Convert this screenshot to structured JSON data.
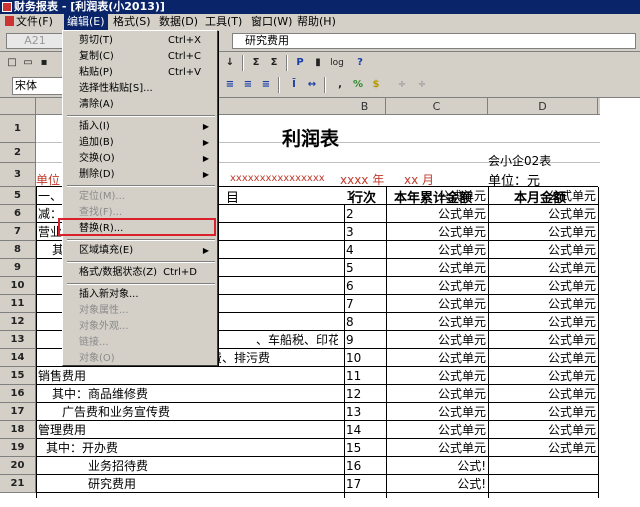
{
  "window": {
    "title": "财务报表 - [利润表(小2013)]"
  },
  "menubar": {
    "items": [
      "文件(F)",
      "编辑(E)",
      "格式(S)",
      "数据(D)",
      "工具(T)",
      "窗口(W)",
      "帮助(H)"
    ]
  },
  "formula_bar": {
    "cell_ref": "A21",
    "content": "研究费用"
  },
  "toolbar": {
    "font": "宋体",
    "zoom_btn": "P",
    "log_btn": "log"
  },
  "edit_menu": {
    "items": [
      {
        "label": "剪切(T)",
        "shortcut": "Ctrl+X"
      },
      {
        "label": "复制(C)",
        "shortcut": "Ctrl+C"
      },
      {
        "label": "粘贴(P)",
        "shortcut": "Ctrl+V"
      },
      {
        "label": "选择性粘贴[S]...",
        "shortcut": ""
      },
      {
        "label": "清除(A)",
        "shortcut": ""
      },
      {
        "label": "插入(I)",
        "shortcut": ""
      },
      {
        "label": "追加(B)",
        "shortcut": ""
      },
      {
        "label": "交换(O)",
        "shortcut": ""
      },
      {
        "label": "删除(D)",
        "shortcut": ""
      },
      {
        "label": "定位(M)...",
        "shortcut": ""
      },
      {
        "label": "查找(F)...",
        "shortcut": ""
      },
      {
        "label": "替换(R)...",
        "shortcut": ""
      },
      {
        "label": "区域填充(E)",
        "shortcut": ""
      },
      {
        "label": "格式/数据状态(Z)",
        "shortcut": "Ctrl+D"
      },
      {
        "label": "插入新对象...",
        "shortcut": ""
      },
      {
        "label": "对象属性...",
        "shortcut": ""
      },
      {
        "label": "对象外观...",
        "shortcut": ""
      },
      {
        "label": "链接...",
        "shortcut": ""
      },
      {
        "label": "对象(O)",
        "shortcut": ""
      }
    ]
  },
  "sheet": {
    "columns": [
      "B",
      "C",
      "D"
    ],
    "rows": [
      "1",
      "2",
      "3",
      "5",
      "6",
      "7",
      "8",
      "9",
      "10",
      "11",
      "12",
      "13",
      "14",
      "15",
      "16",
      "17",
      "18",
      "19",
      "20",
      "21"
    ],
    "title": "利润表",
    "form_no": "会小企02表",
    "unit": "单位：元",
    "unit_label": "单位",
    "date_mask": "xxxxxxxxxxxxxxxx",
    "year_mask": "xxxx 年",
    "month_mask": "xx 月",
    "col_headers": [
      "目",
      "行次",
      "本年累计金额",
      "本月金额"
    ],
    "row_items": [
      {
        "a": "一、",
        "b": "1",
        "c": "公式单元",
        "d": "公式单元"
      },
      {
        "a": "减：",
        "b": "2",
        "c": "公式单元",
        "d": "公式单元"
      },
      {
        "a": "营业",
        "b": "3",
        "c": "公式单元",
        "d": "公式单元"
      },
      {
        "a": "其",
        "b": "4",
        "c": "公式单元",
        "d": "公式单元"
      },
      {
        "a": "",
        "b": "5",
        "c": "公式单元",
        "d": "公式单元"
      },
      {
        "a": "",
        "b": "6",
        "c": "公式单元",
        "d": "公式单元"
      },
      {
        "a": "",
        "b": "7",
        "c": "公式单元",
        "d": "公式单元"
      },
      {
        "a": "",
        "b": "8",
        "c": "公式单元",
        "d": "公式单元"
      },
      {
        "a": "、车船税、印花税",
        "b": "9",
        "c": "公式单元",
        "d": "公式单元"
      },
      {
        "a": "教育费附加、矿产资源补偿费、排污费",
        "b": "10",
        "c": "公式单元",
        "d": "公式单元"
      },
      {
        "a": "销售费用",
        "b": "11",
        "c": "公式单元",
        "d": "公式单元"
      },
      {
        "a": "其中：商品维修费",
        "b": "12",
        "c": "公式单元",
        "d": "公式单元"
      },
      {
        "a": "广告费和业务宣传费",
        "b": "13",
        "c": "公式单元",
        "d": "公式单元"
      },
      {
        "a": "管理费用",
        "b": "14",
        "c": "公式单元",
        "d": "公式单元"
      },
      {
        "a": "其中：开办费",
        "b": "15",
        "c": "公式单元",
        "d": "公式单元"
      },
      {
        "a": "业务招待费",
        "b": "16",
        "c": "公式!",
        "d": ""
      },
      {
        "a": "研究费用",
        "b": "17",
        "c": "公式!",
        "d": ""
      }
    ]
  }
}
